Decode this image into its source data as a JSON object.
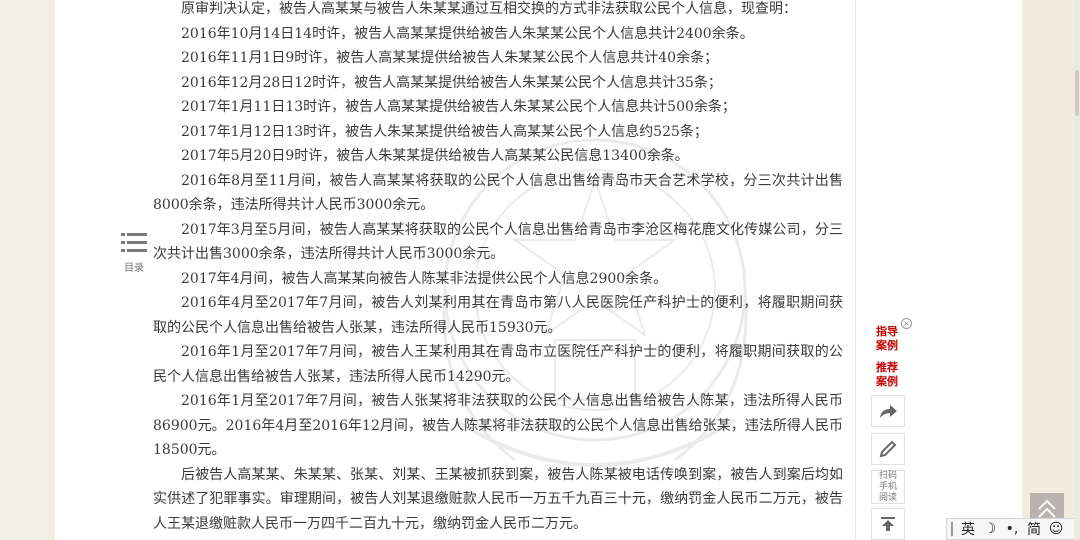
{
  "document": {
    "paragraphs": [
      "原审判决认定，被告人高某某与被告人朱某某通过互相交换的方式非法获取公民个人信息，现查明：",
      "2016年10月14日14时许，被告人高某某提供给被告人朱某某公民个人信息共计2400余条。",
      "2016年11月1日9时许，被告人高某某提供给被告人朱某某公民个人信息共计40余条；",
      "2016年12月28日12时许，被告人高某某提供给被告人朱某某公民个人信息共计35条；",
      "2017年1月11日13时许，被告人高某某提供给被告人朱某某公民个人信息共计500余条；",
      "2017年1月12日13时许，被告人朱某某提供给被告人高某某公民个人信息约525条；",
      "2017年5月20日9时许，被告人朱某某提供给被告人高某某公民信息13400余条。",
      "2016年8月至11月间，被告人高某某将获取的公民个人信息出售给青岛市天合艺术学校，分三次共计出售8000余条，违法所得共计人民币3000余元。",
      "2017年3月至5月间，被告人高某某将获取的公民个人信息出售给青岛市李沧区梅花鹿文化传媒公司，分三次共计出售3000余条，违法所得共计人民币3000余元。",
      "2017年4月间，被告人高某某向被告人陈某非法提供公民个人信息2900余条。",
      "2016年4月至2017年7月间，被告人刘某利用其在青岛市第八人民医院任产科护士的便利，将履职期间获取的公民个人信息出售给被告人张某，违法所得人民币15930元。",
      "2016年1月至2017年7月间，被告人王某利用其在青岛市立医院任产科护士的便利，将履职期间获取的公民个人信息出售给被告人张某，违法所得人民币14290元。",
      "2016年1月至2017年7月间，被告人张某将非法获取的公民个人信息出售给被告人陈某，违法所得人民币86900元。2016年4月至2016年12月间，被告人陈某将非法获取的公民个人信息出售给张某，违法所得人民币18500元。",
      "后被告人高某某、朱某某、张某、刘某、王某被抓获到案，被告人陈某被电话传唤到案，被告人到案后均如实供述了犯罪事实。审理期间，被告人刘某退缴赃款人民币一万五千九百三十元，缴纳罚金人民币二万元，被告人王某退缴赃款人民币一万四千二百九十元，缴纳罚金人民币二万元。"
    ]
  },
  "toc": {
    "label": "目录",
    "icon": "list-icon"
  },
  "sidebar": {
    "close_symbol": "×",
    "link_guide": "指导案例",
    "link_recommend": "推荐案例",
    "share_icon": "share-arrow-icon",
    "edit_icon": "pencil-icon",
    "qr_label": "扫码手机阅读",
    "top_icon": "arrow-up-icon"
  },
  "ime": {
    "lang": "英",
    "moon": "☽",
    "punct": "•,",
    "simplified": "简",
    "emoji": "☺"
  },
  "colors": {
    "accent_red": "#c40000",
    "text": "#3a3a3a",
    "page_bg": "#ffffff",
    "outer_bg": "#f0ece0"
  }
}
